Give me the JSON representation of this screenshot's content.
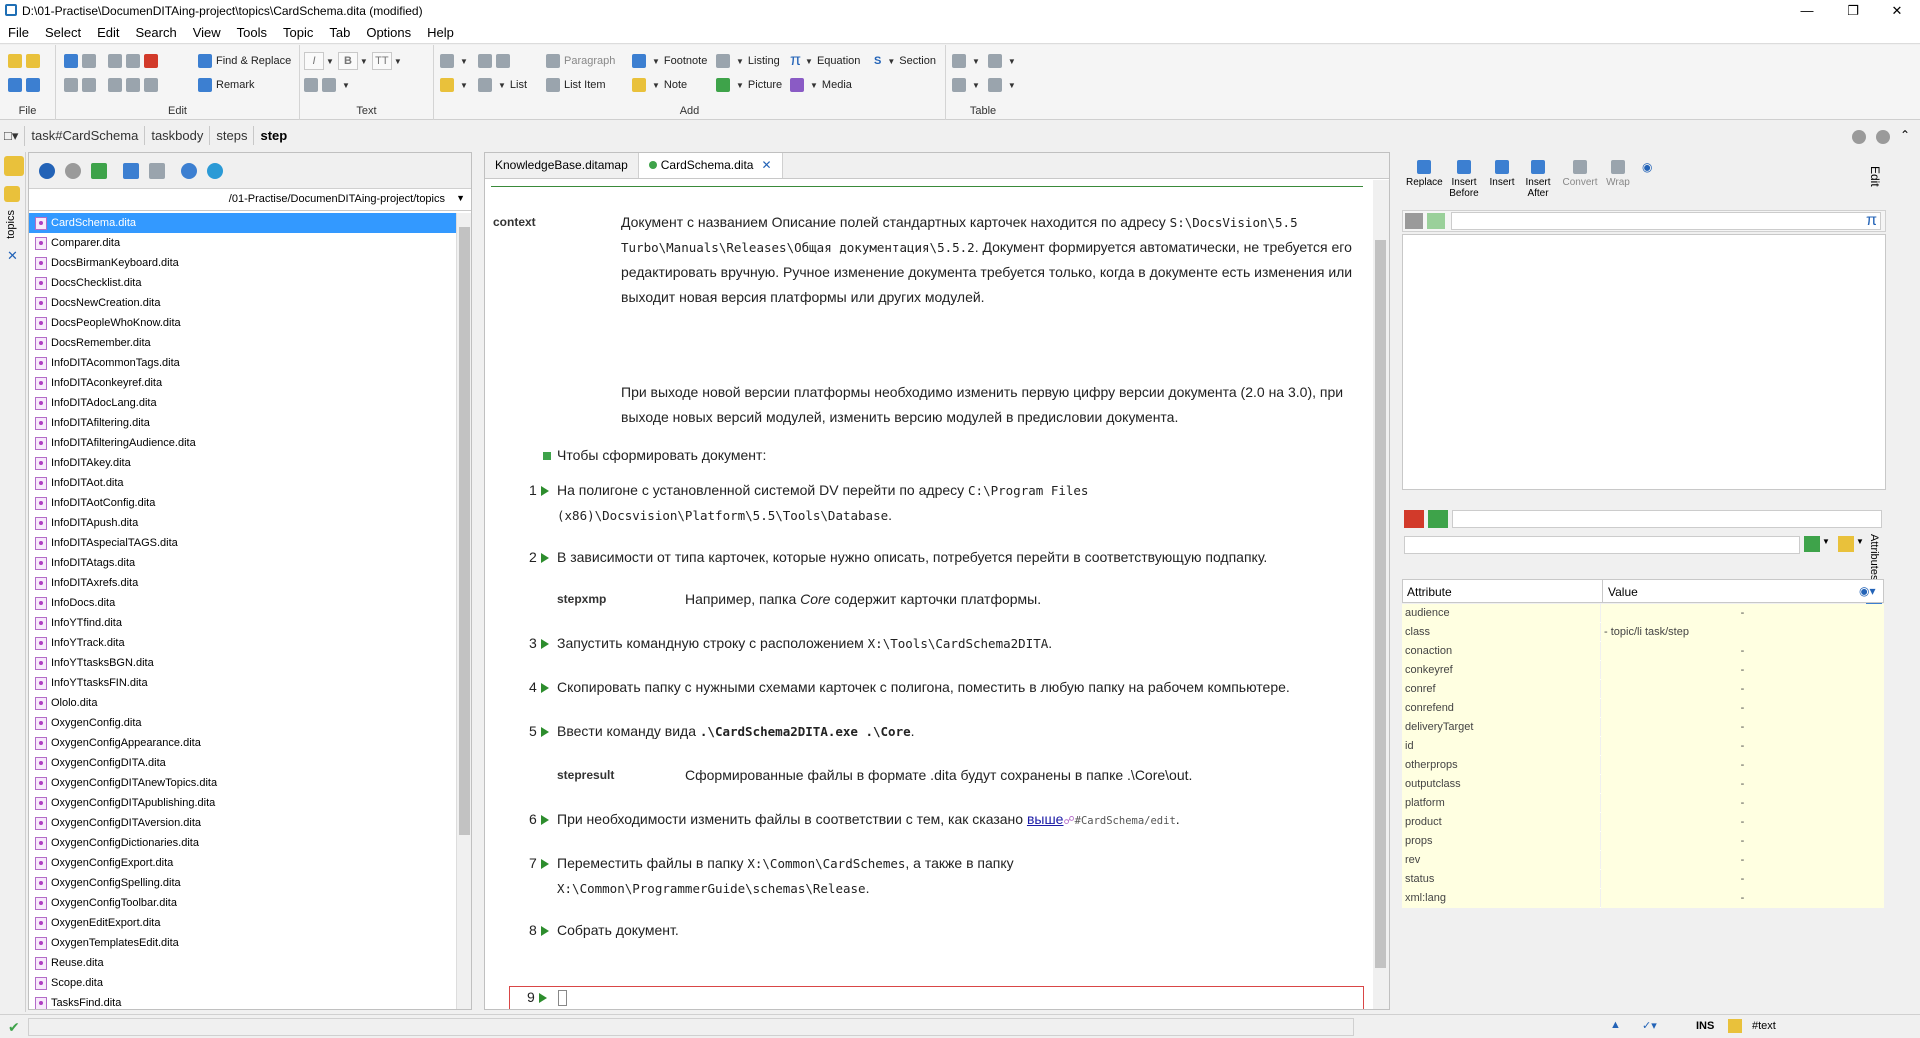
{
  "window": {
    "title": "D:\\01-Practise\\DocumenDITAing-project\\topics\\CardSchema.dita (modified)"
  },
  "menu": [
    "File",
    "Select",
    "Edit",
    "Search",
    "View",
    "Tools",
    "Topic",
    "Tab",
    "Options",
    "Help"
  ],
  "ribbon": {
    "groups": {
      "file": "File",
      "edit": "Edit",
      "text": "Text",
      "add": "Add",
      "table": "Table"
    },
    "find_replace": "Find & Replace",
    "remark": "Remark",
    "paragraph": "Paragraph",
    "footnote": "Footnote",
    "listing": "Listing",
    "equation": "Equation",
    "section": "Section",
    "list": "List",
    "list_item": "List Item",
    "note": "Note",
    "picture": "Picture",
    "media": "Media",
    "italic": "I",
    "bold": "B",
    "tt": "TT"
  },
  "breadcrumb": [
    "task#CardSchema",
    "taskbody",
    "steps",
    "step"
  ],
  "dm": {
    "side_label": "topics",
    "path": "/01-Practise/DocumenDITAing-project/topics",
    "files": [
      "CardSchema.dita",
      "Comparer.dita",
      "DocsBirmanKeyboard.dita",
      "DocsChecklist.dita",
      "DocsNewCreation.dita",
      "DocsPeopleWhoKnow.dita",
      "DocsRemember.dita",
      "InfoDITAcommonTags.dita",
      "InfoDITAconkeyref.dita",
      "InfoDITAdocLang.dita",
      "InfoDITAfiltering.dita",
      "InfoDITAfilteringAudience.dita",
      "InfoDITAkey.dita",
      "InfoDITAot.dita",
      "InfoDITAotConfig.dita",
      "InfoDITApush.dita",
      "InfoDITAspecialTAGS.dita",
      "InfoDITAtags.dita",
      "InfoDITAxrefs.dita",
      "InfoDocs.dita",
      "InfoYTfind.dita",
      "InfoYTrack.dita",
      "InfoYTtasksBGN.dita",
      "InfoYTtasksFIN.dita",
      "Ololo.dita",
      "OxygenConfig.dita",
      "OxygenConfigAppearance.dita",
      "OxygenConfigDITA.dita",
      "OxygenConfigDITAnewTopics.dita",
      "OxygenConfigDITApublishing.dita",
      "OxygenConfigDITAversion.dita",
      "OxygenConfigDictionaries.dita",
      "OxygenConfigExport.dita",
      "OxygenConfigSpelling.dita",
      "OxygenConfigToolbar.dita",
      "OxygenEditExport.dita",
      "OxygenTemplatesEdit.dita",
      "Reuse.dita",
      "Scope.dita",
      "TasksFind.dita"
    ]
  },
  "tabs": [
    "KnowledgeBase.ditamap",
    "CardSchema.dita"
  ],
  "doc": {
    "context_label": "context",
    "ctx_a": "Документ с названием Описание полей стандартных карточек находится по адресу ",
    "ctx_path": "S:\\DocsVision\\5.5 Turbo\\Manuals\\Releases\\Общая документация\\5.5.2",
    "ctx_b": ". Документ формируется автоматически, не требуется его редактировать вручную. Ручное изменение документа требуется только, когда в документе есть изменения или выходит новая версия платформы или других модулей.",
    "ctx2": "При выходе новой версии платформы необходимо изменить первую цифру версии документа (2.0 на 3.0), при выходе новых версий модулей, изменить версию модулей в предисловии документа.",
    "prereq": "Чтобы сформировать документ:",
    "s1_num": "1",
    "s1_a": "На полигоне с установленной системой DV перейти по адресу ",
    "s1_path": "C:\\Program Files (x86)\\Docsvision\\Platform\\5.5\\Tools\\Database",
    "s2_num": "2",
    "s2": "В зависимости от типа карточек, которые нужно описать, потребуется перейти в соответствующую подпапку.",
    "stepxmp_label": "stepxmp",
    "stepxmp_a": "Например, папка ",
    "stepxmp_i": "Core",
    "stepxmp_b": " содержит карточки платформы.",
    "s3_num": "3",
    "s3_a": "Запустить командную строку с расположением ",
    "s3_path": "X:\\Tools\\CardSchema2DITA",
    "s4_num": "4",
    "s4": "Скопировать папку с нужными схемами карточек с полигона, поместить в любую папку на рабочем компьютере.",
    "s5_num": "5",
    "s5_a": "Ввести команду вида ",
    "s5_cmd": ".\\CardSchema2DITA.exe .\\Core",
    "stepresult_label": "stepresult",
    "stepresult": "Сформированные файлы в формате .dita будут сохранены в папке .\\Core\\out.",
    "s6_num": "6",
    "s6_a": "При необходимости изменить файлы в соответствии с тем, как сказано ",
    "s6_link": "выше",
    "s6_ref": "#CardSchema/edit",
    "s7_num": "7",
    "s7_a": "Переместить файлы в папку ",
    "s7_path1": "X:\\Common\\CardSchemes",
    "s7_b": ", а также в папку ",
    "s7_path2": "X:\\Common\\ProgrammerGuide\\schemas\\Release",
    "s8_num": "8",
    "s8": "Собрать документ.",
    "s9_num": "9"
  },
  "right": {
    "buttons": {
      "replace": "Replace",
      "insert_before": "Insert Before",
      "insert": "Insert",
      "insert_after": "Insert After",
      "convert": "Convert",
      "wrap": "Wrap"
    },
    "side_edit": "Edit",
    "side_attributes": "Attributes",
    "attr_header": {
      "name": "Attribute",
      "value": "Value"
    },
    "attributes": [
      {
        "name": "audience",
        "value": "-"
      },
      {
        "name": "class",
        "value": "- topic/li task/step"
      },
      {
        "name": "conaction",
        "value": "-"
      },
      {
        "name": "conkeyref",
        "value": "-"
      },
      {
        "name": "conref",
        "value": "-"
      },
      {
        "name": "conrefend",
        "value": "-"
      },
      {
        "name": "deliveryTarget",
        "value": "-"
      },
      {
        "name": "id",
        "value": "-"
      },
      {
        "name": "otherprops",
        "value": "-"
      },
      {
        "name": "outputclass",
        "value": "-"
      },
      {
        "name": "platform",
        "value": "-"
      },
      {
        "name": "product",
        "value": "-"
      },
      {
        "name": "props",
        "value": "-"
      },
      {
        "name": "rev",
        "value": "-"
      },
      {
        "name": "status",
        "value": "-"
      },
      {
        "name": "xml:lang",
        "value": "-"
      }
    ]
  },
  "status": {
    "mode": "INS",
    "node": "#text"
  }
}
